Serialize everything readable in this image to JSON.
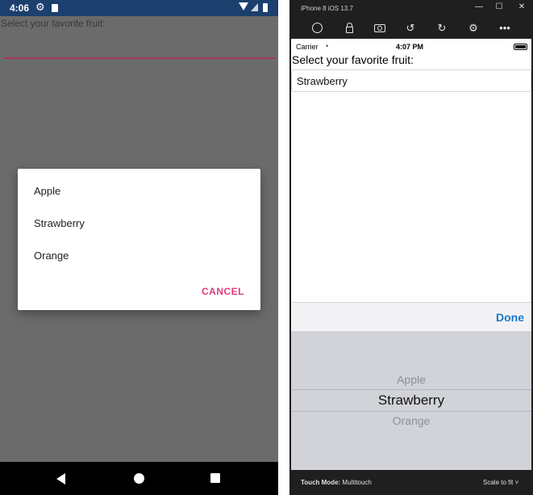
{
  "android": {
    "status_time": "4:06",
    "picker_label": "Select your favorite fruit:",
    "dialog_options": [
      "Apple",
      "Strawberry",
      "Orange"
    ],
    "cancel_label": "CANCEL",
    "accent_color": "#e23b7a",
    "status_bar_color": "#1c3f6e"
  },
  "simulator": {
    "window_title": "iPhone 8 iOS 13.7",
    "toolbar_icons": [
      "home-icon",
      "lock-icon",
      "screenshot-icon",
      "rotate-left-icon",
      "rotate-right-icon",
      "settings-icon",
      "more-icon"
    ],
    "status_carrier": "Carrier",
    "status_time": "4:07 PM",
    "picker_label": "Select your favorite fruit:",
    "selected_value": "Strawberry",
    "done_label": "Done",
    "wheel_items": [
      "Apple",
      "Strawberry",
      "Orange"
    ],
    "touch_mode_label": "Touch Mode:",
    "touch_mode_value": "Multitouch",
    "scale_label": "Scale to fit",
    "done_color": "#1a7ad1"
  }
}
